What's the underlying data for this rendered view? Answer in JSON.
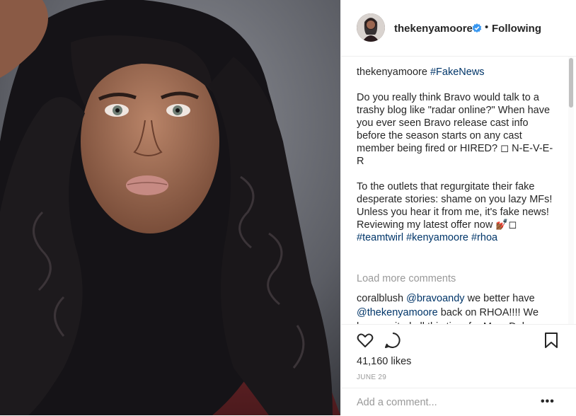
{
  "header": {
    "username": "thekenyamoore",
    "separator": "•",
    "follow_status": "Following"
  },
  "caption": {
    "username": "thekenyamoore",
    "hashtag": "#FakeNews",
    "paragraph1": "Do you really think Bravo would talk to a trashy blog like \"radar online?\" When have you ever seen Bravo release cast info before the season starts on any cast member being fired or HIRED? ◻ N-E-V-E-R",
    "paragraph2": "To the outlets that regurgitate their fake desperate stories: shame on you lazy MFs!\nUnless you hear it from me, it's fake news!\nReviewing my latest offer now 💅🏾◻",
    "hashtags": "#teamtwirl #kenyamoore #rhoa"
  },
  "load_more": "Load more comments",
  "comment": {
    "username": "coralblush",
    "mention1": "@bravoandy",
    "text1": " we better have ",
    "mention2": "@thekenyamoore",
    "text2": " back on RHOA!!!! We have waited all this time for Marc Daly"
  },
  "actions": {
    "likes": "41,160 likes",
    "date": "JUNE 29"
  },
  "add_comment": {
    "placeholder": "Add a comment...",
    "more": "•••"
  },
  "colors": {
    "link": "#003569",
    "muted": "#999999",
    "text": "#262626",
    "verified": "#3897f0",
    "border": "#efefef"
  },
  "icons": [
    "heart-icon",
    "comment-icon",
    "bookmark-icon",
    "verified-badge-icon",
    "more-options-icon"
  ]
}
